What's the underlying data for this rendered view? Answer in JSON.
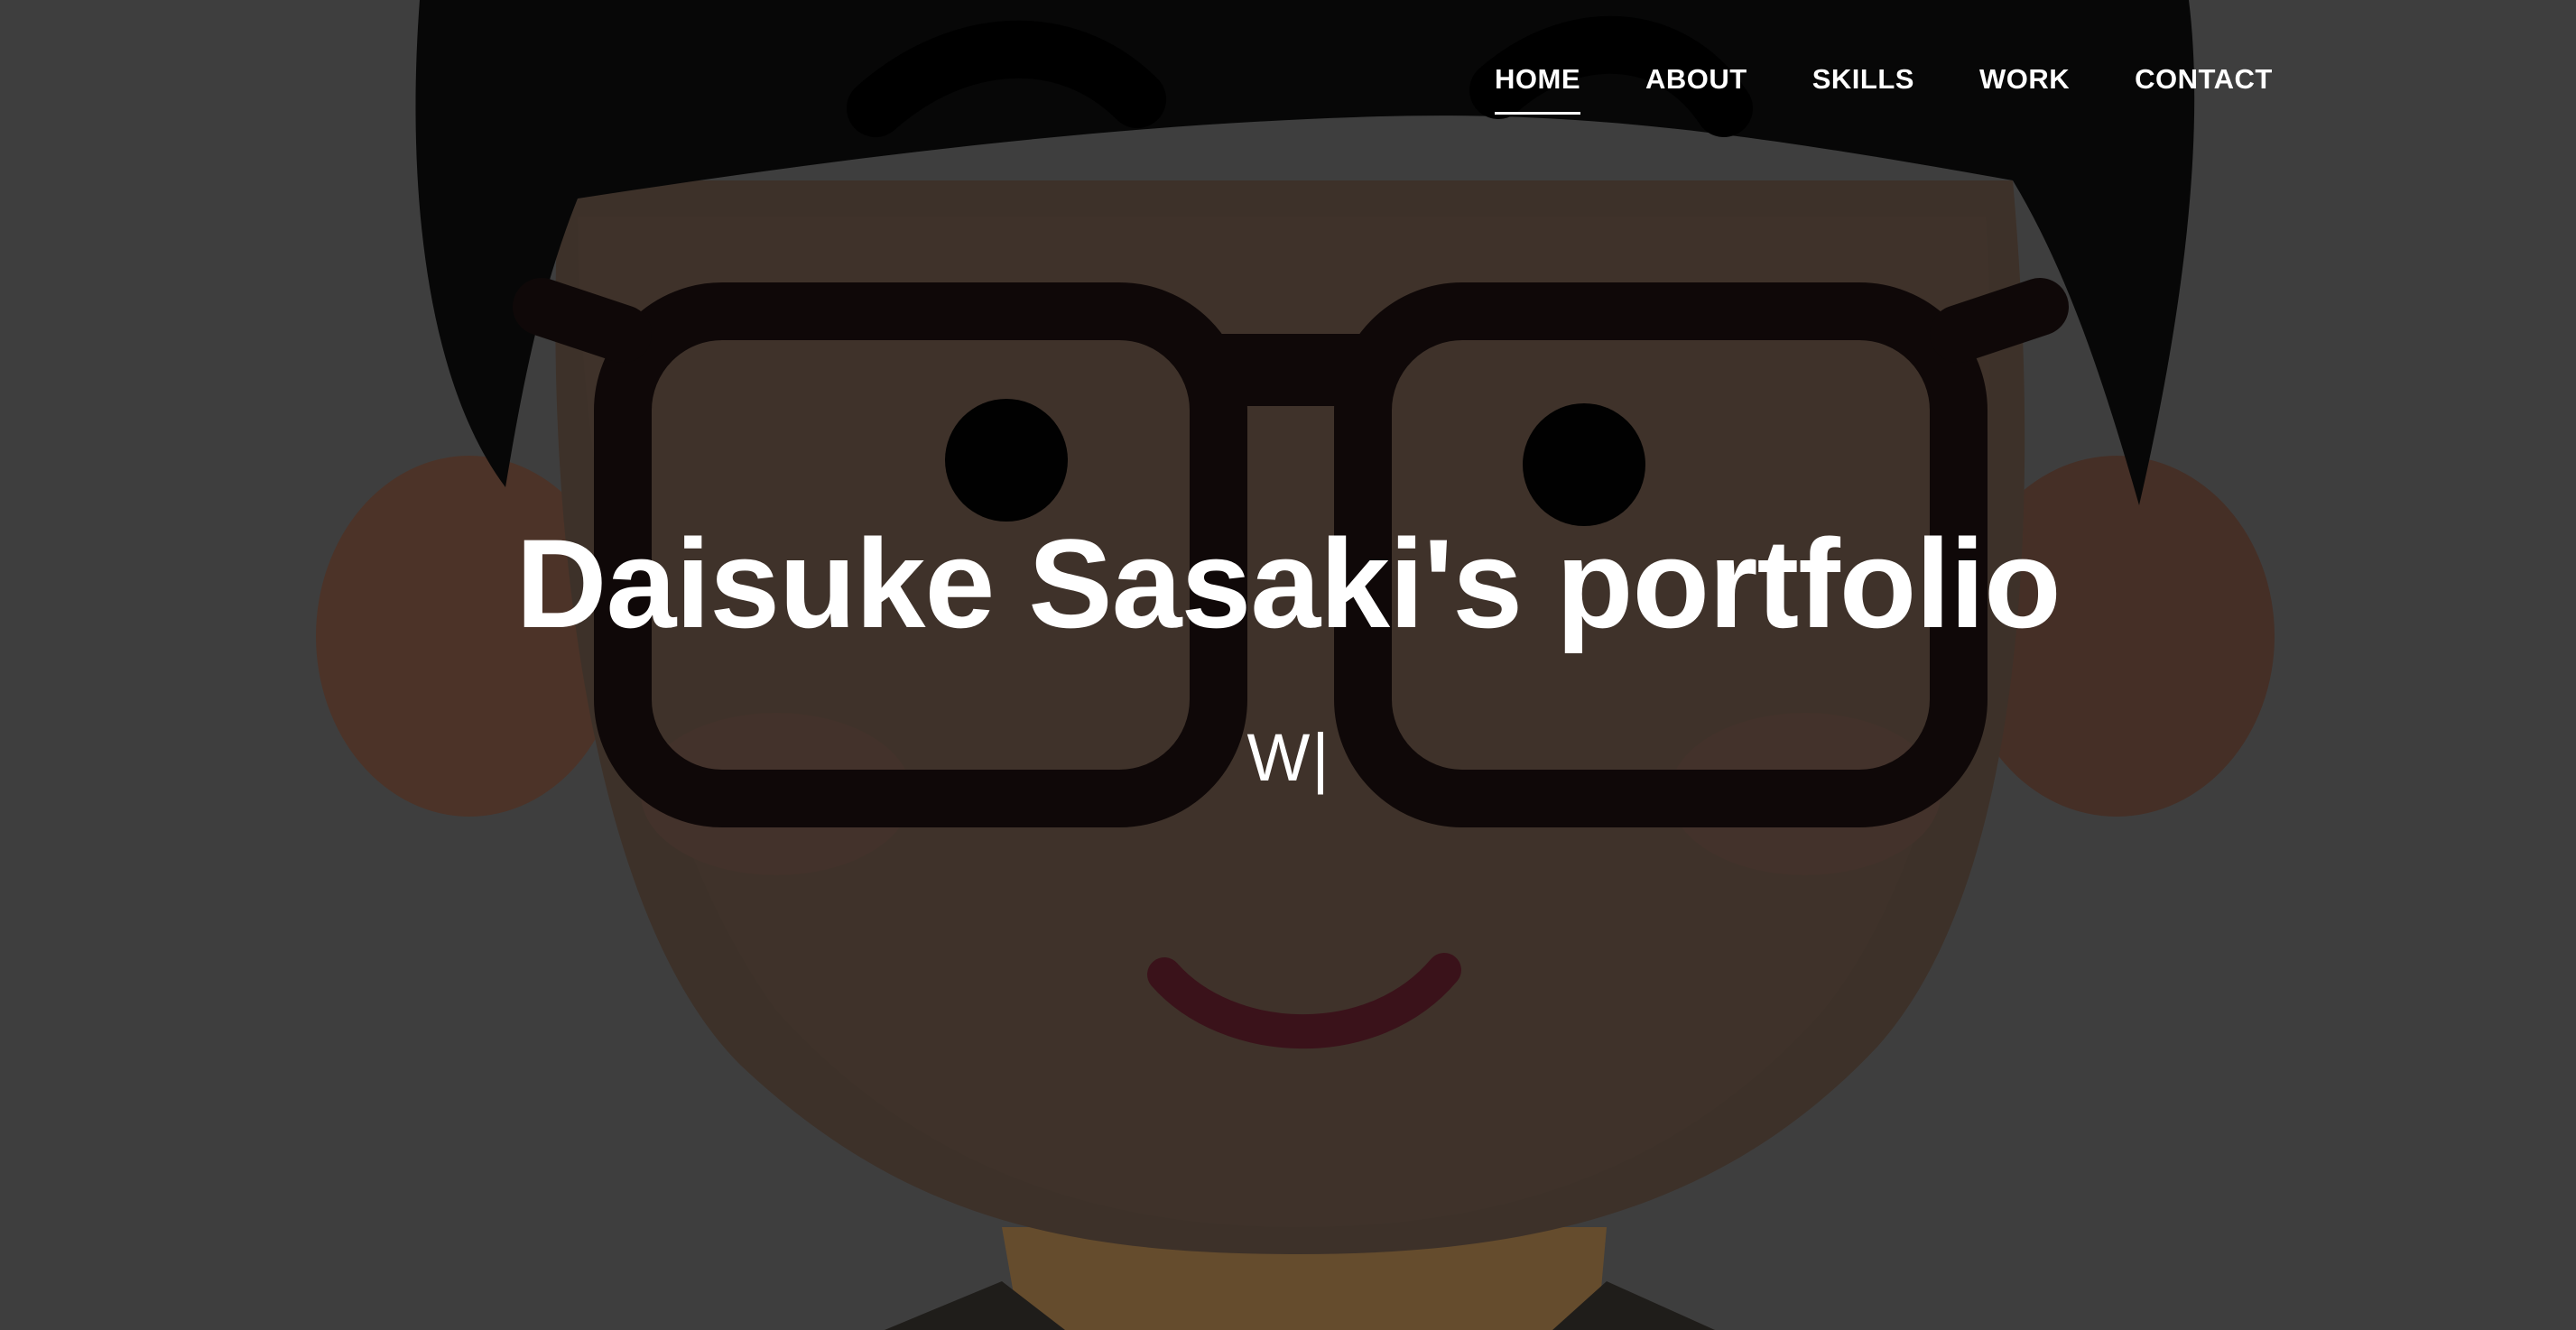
{
  "nav": {
    "items": [
      {
        "label": "HOME",
        "active": true
      },
      {
        "label": "ABOUT",
        "active": false
      },
      {
        "label": "SKILLS",
        "active": false
      },
      {
        "label": "WORK",
        "active": false
      },
      {
        "label": "CONTACT",
        "active": false
      }
    ]
  },
  "hero": {
    "title": "Daisuke Sasaki's portfolio",
    "typed_text": "W",
    "cursor": "|",
    "background_image": "cartoon-avatar-with-glasses",
    "overlay_color": "#000000"
  }
}
